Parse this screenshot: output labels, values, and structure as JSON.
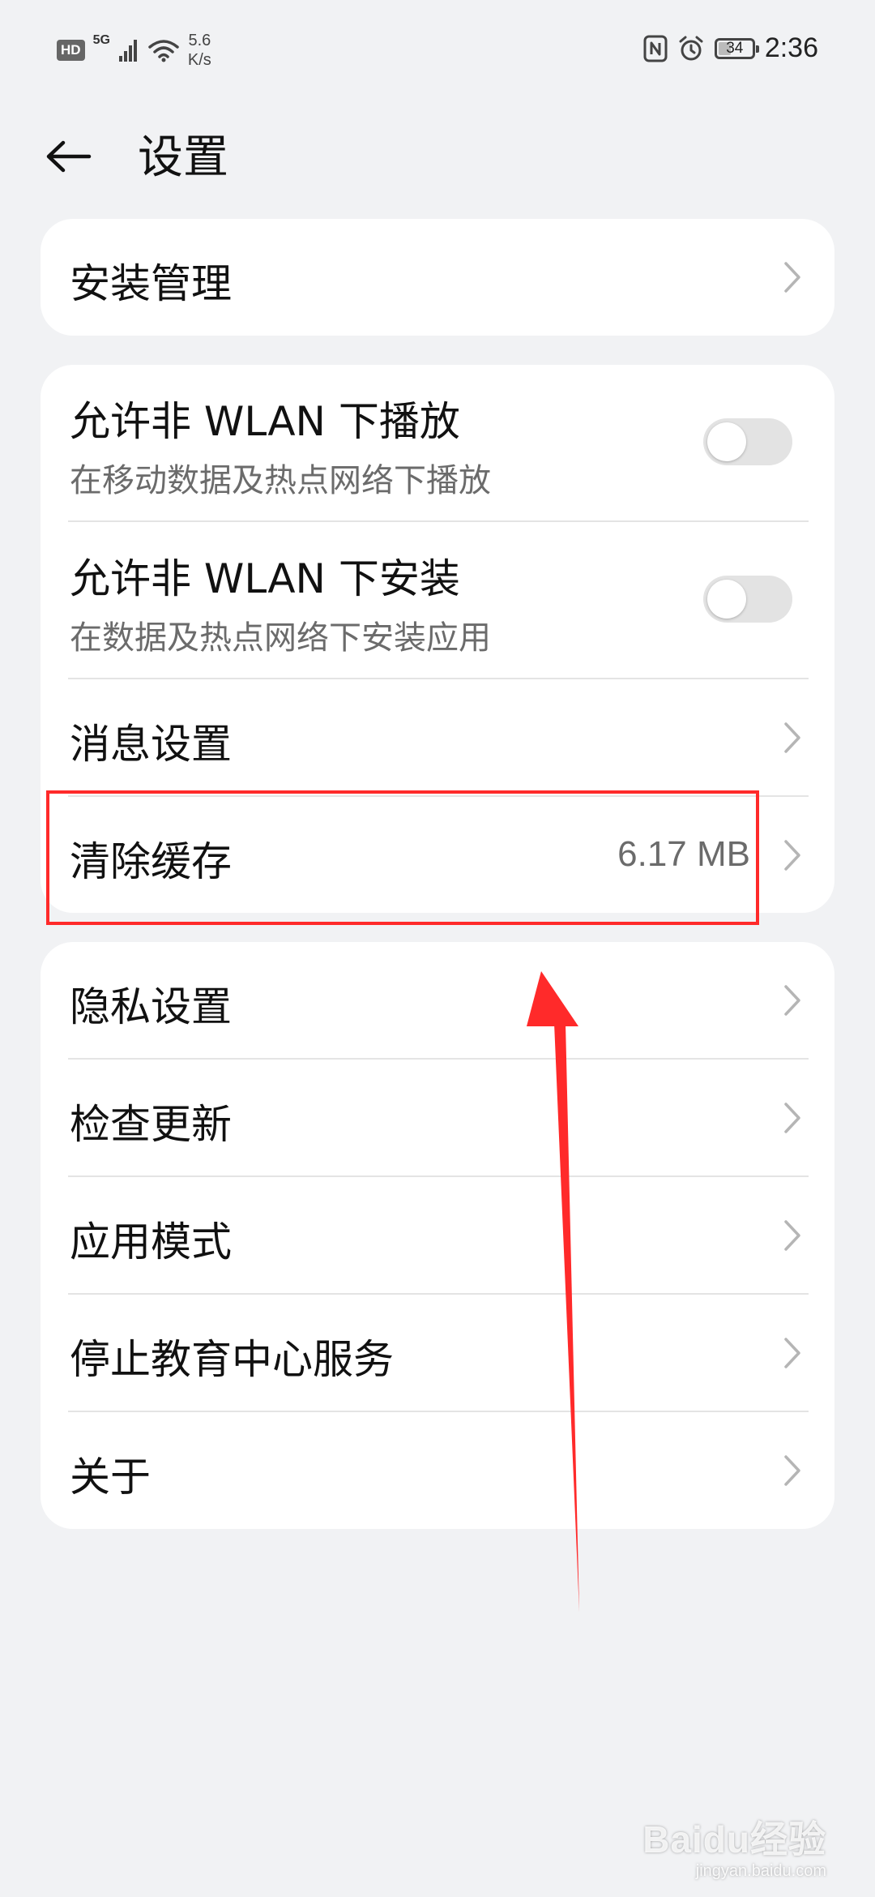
{
  "status_bar": {
    "hd_badge": "HD",
    "network_label": "5G",
    "speed_value": "5.6",
    "speed_unit": "K/s",
    "battery_level": "34",
    "time": "2:36"
  },
  "header": {
    "title": "设置",
    "back_icon": "arrow-left-icon"
  },
  "groups": [
    {
      "items": [
        {
          "title": "安装管理",
          "type": "link"
        }
      ]
    },
    {
      "items": [
        {
          "title": "允许非 WLAN 下播放",
          "subtitle": "在移动数据及热点网络下播放",
          "type": "toggle",
          "enabled": false
        },
        {
          "title": "允许非 WLAN 下安装",
          "subtitle": "在数据及热点网络下安装应用",
          "type": "toggle",
          "enabled": false
        },
        {
          "title": "消息设置",
          "type": "link"
        },
        {
          "title": "清除缓存",
          "value": "6.17 MB",
          "type": "link"
        }
      ]
    },
    {
      "items": [
        {
          "title": "隐私设置",
          "type": "link"
        },
        {
          "title": "检查更新",
          "type": "link"
        },
        {
          "title": "应用模式",
          "type": "link"
        },
        {
          "title": "停止教育中心服务",
          "type": "link"
        },
        {
          "title": "关于",
          "type": "link"
        }
      ]
    }
  ],
  "annotation": {
    "highlight_color": "#ff2a2a",
    "arrow_color": "#ff2a2a"
  },
  "watermark": {
    "logo": "Baidu经验",
    "url": "jingyan.baidu.com"
  },
  "colors": {
    "background": "#f1f2f4",
    "card": "#ffffff",
    "toggle_off": "#e3e3e3"
  }
}
